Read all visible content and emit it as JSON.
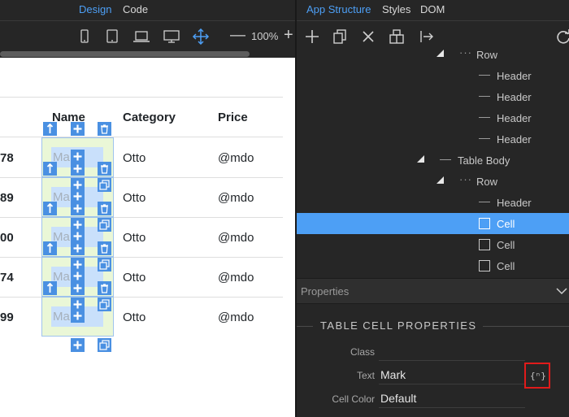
{
  "left_tabs": {
    "design": "Design",
    "code": "Code"
  },
  "toolbar": {
    "icons": [
      "phone-icon",
      "tablet-icon",
      "laptop-icon",
      "desktop-icon",
      "move-arrows-icon"
    ],
    "zoom": "100%",
    "zoom_minus": "—",
    "zoom_plus": "+"
  },
  "table": {
    "headers": {
      "name": "Name",
      "category": "Category",
      "price": "Price"
    },
    "rows": [
      {
        "num": "78",
        "name": "Ma",
        "category": "Otto",
        "price": "@mdo"
      },
      {
        "num": "89",
        "name": "Ma",
        "category": "Otto",
        "price": "@mdo"
      },
      {
        "num": "00",
        "name": "Ma",
        "category": "Otto",
        "price": "@mdo"
      },
      {
        "num": "74",
        "name": "Ma",
        "category": "Otto",
        "price": "@mdo"
      },
      {
        "num": "99",
        "name": "Ma",
        "category": "Otto",
        "price": "@mdo"
      }
    ]
  },
  "right_tabs": {
    "app_structure": "App Structure",
    "styles": "Styles",
    "dom": "DOM"
  },
  "tree": [
    {
      "label": "Row",
      "kind": "row"
    },
    {
      "label": "Header",
      "kind": "leaf"
    },
    {
      "label": "Header",
      "kind": "leaf"
    },
    {
      "label": "Header",
      "kind": "leaf"
    },
    {
      "label": "Header",
      "kind": "leaf"
    },
    {
      "label": "Table Body",
      "kind": "group"
    },
    {
      "label": "Row",
      "kind": "row"
    },
    {
      "label": "Header",
      "kind": "leaf"
    },
    {
      "label": "Cell",
      "kind": "cell",
      "selected": true
    },
    {
      "label": "Cell",
      "kind": "cell"
    },
    {
      "label": "Cell",
      "kind": "cell"
    }
  ],
  "properties": {
    "header": "Properties",
    "section_title": "TABLE CELL PROPERTIES",
    "class_label": "Class",
    "class_value": "",
    "text_label": "Text",
    "text_value": "Mark",
    "cell_color_label": "Cell Color",
    "cell_color_value": "Default",
    "fx_glyph": "{ⁿ}"
  },
  "colors": {
    "accent": "#4d9ff5",
    "panel_bg": "#262626",
    "selected_row": "#4d9ff5",
    "highlight_border": "#e01b1b",
    "cell_overlay": "#eaf7d7",
    "handle_blue": "#4a90e2"
  }
}
